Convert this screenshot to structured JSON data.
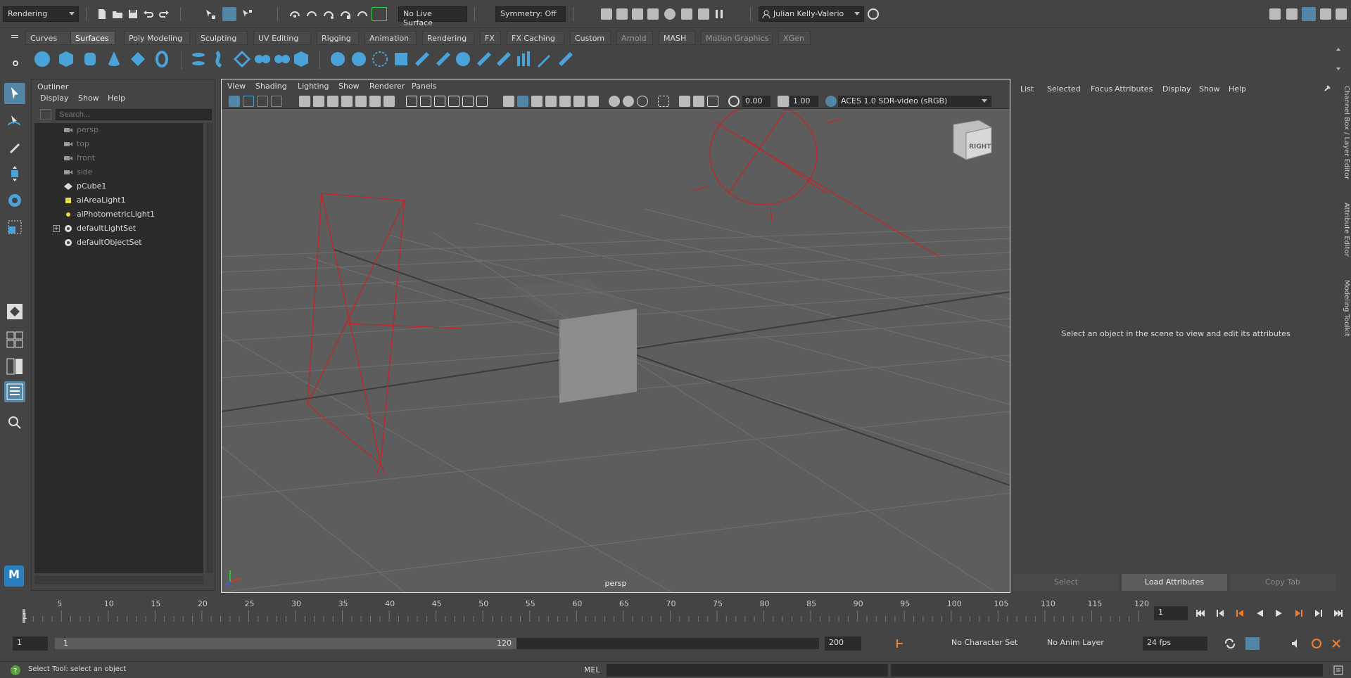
{
  "status_line": {
    "menu_set": "Rendering",
    "live_surface": "No Live Surface",
    "symmetry": "Symmetry: Off",
    "user": "Julian Kelly-Valerio"
  },
  "shelf": {
    "tabs": [
      "Curves",
      "Surfaces",
      "Poly Modeling",
      "Sculpting",
      "UV Editing",
      "Rigging",
      "Animation",
      "Rendering",
      "FX",
      "FX Caching",
      "Custom",
      "Arnold",
      "MASH",
      "Motion Graphics",
      "XGen"
    ],
    "active_tab": "Surfaces"
  },
  "outliner": {
    "title": "Outliner",
    "menu": [
      "Display",
      "Show",
      "Help"
    ],
    "search_placeholder": "Search...",
    "items": [
      {
        "label": "persp",
        "icon": "camera-icon",
        "dim": true
      },
      {
        "label": "top",
        "icon": "camera-icon",
        "dim": true
      },
      {
        "label": "front",
        "icon": "camera-icon",
        "dim": true
      },
      {
        "label": "side",
        "icon": "camera-icon",
        "dim": true
      },
      {
        "label": "pCube1",
        "icon": "mesh-icon",
        "dim": false
      },
      {
        "label": "aiAreaLight1",
        "icon": "area-light-icon",
        "dim": false
      },
      {
        "label": "aiPhotometricLight1",
        "icon": "photometric-light-icon",
        "dim": false
      },
      {
        "label": "defaultLightSet",
        "icon": "set-icon",
        "dim": false
      },
      {
        "label": "defaultObjectSet",
        "icon": "set-icon",
        "dim": false
      }
    ]
  },
  "viewport": {
    "menu": [
      "View",
      "Shading",
      "Lighting",
      "Show",
      "Renderer",
      "Panels"
    ],
    "exposure": "0.00",
    "gamma": "1.00",
    "color_space": "ACES 1.0 SDR-video (sRGB)",
    "camera_label": "persp",
    "view_cube_label": "RIGHT"
  },
  "attribute_editor": {
    "menu": [
      "List",
      "Selected",
      "Focus",
      "Attributes",
      "Display",
      "Show",
      "Help"
    ],
    "empty_message": "Select an object in the scene to view and edit its attributes",
    "buttons": [
      "Select",
      "Load Attributes",
      "Copy Tab"
    ]
  },
  "side_tabs": [
    "Channel Box / Layer Editor",
    "Attribute Editor",
    "Modeling Toolkit"
  ],
  "time_slider": {
    "ticks": [
      "5",
      "10",
      "15",
      "20",
      "25",
      "30",
      "35",
      "40",
      "45",
      "50",
      "55",
      "60",
      "65",
      "70",
      "75",
      "80",
      "85",
      "90",
      "95",
      "100",
      "105",
      "110",
      "115",
      "120"
    ],
    "current_marker": "1",
    "current_frame": "1"
  },
  "range_slider": {
    "start": "1",
    "range_start": "1",
    "range_end": "120",
    "end": "200",
    "character_set": "No Character Set",
    "anim_layer": "No Anim Layer",
    "fps": "24 fps"
  },
  "command_line": {
    "help_text": "Select Tool: select an object",
    "language": "MEL"
  },
  "colors": {
    "accent": "#5285a6",
    "light_wire": "#cc2222",
    "background": "#444444"
  }
}
